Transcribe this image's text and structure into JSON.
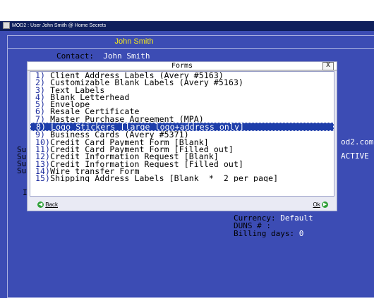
{
  "window": {
    "title": "MOD2 : User John Smith @ Home Secrets"
  },
  "header": {
    "name": "John Smith"
  },
  "contact": {
    "label": "Contact:",
    "value": "John Smith"
  },
  "background": {
    "right_text_1": "od2.com",
    "right_text_2": "ACTIVE",
    "left_fragments": [
      "Su",
      "Su",
      "Su",
      "Su"
    ],
    "left_letter": "I"
  },
  "dialog": {
    "title": "Forms",
    "close_label": "X",
    "items": [
      {
        "num": "1)",
        "label": "Client Address Labels (Avery #5163)"
      },
      {
        "num": "2)",
        "label": "Customizable Blank Labels (Avery #5163)"
      },
      {
        "num": "3)",
        "label": "Text Labels"
      },
      {
        "num": "4)",
        "label": "Blank Letterhead"
      },
      {
        "num": "5)",
        "label": "Envelope"
      },
      {
        "num": "6)",
        "label": "Resale Certificate"
      },
      {
        "num": "7)",
        "label": "Master Purchase Agreement (MPA)"
      },
      {
        "num": "8)",
        "label": "Logo Stickers [large logo+address only]"
      },
      {
        "num": "9)",
        "label": "Business Cards (Avery #5371)"
      },
      {
        "num": "10)",
        "label": "Credit Card Payment Form [Blank]"
      },
      {
        "num": "11)",
        "label": "Credit Card Payment Form [Filled out]"
      },
      {
        "num": "12)",
        "label": "Credit Information Request [Blank]"
      },
      {
        "num": "13)",
        "label": "Credit Information Request [Filled out]"
      },
      {
        "num": "14)",
        "label": "Wire transfer Form"
      },
      {
        "num": "15)",
        "label": "Shipping Address Labels [Blank  *  2 per page]"
      }
    ],
    "back_label": "Back",
    "ok_label": "Ok"
  },
  "details": {
    "currency_label": "Currency:",
    "currency_value": "Default",
    "duns_label": "DUNS # :",
    "billing_label": "Billing days:",
    "billing_value": "0"
  }
}
